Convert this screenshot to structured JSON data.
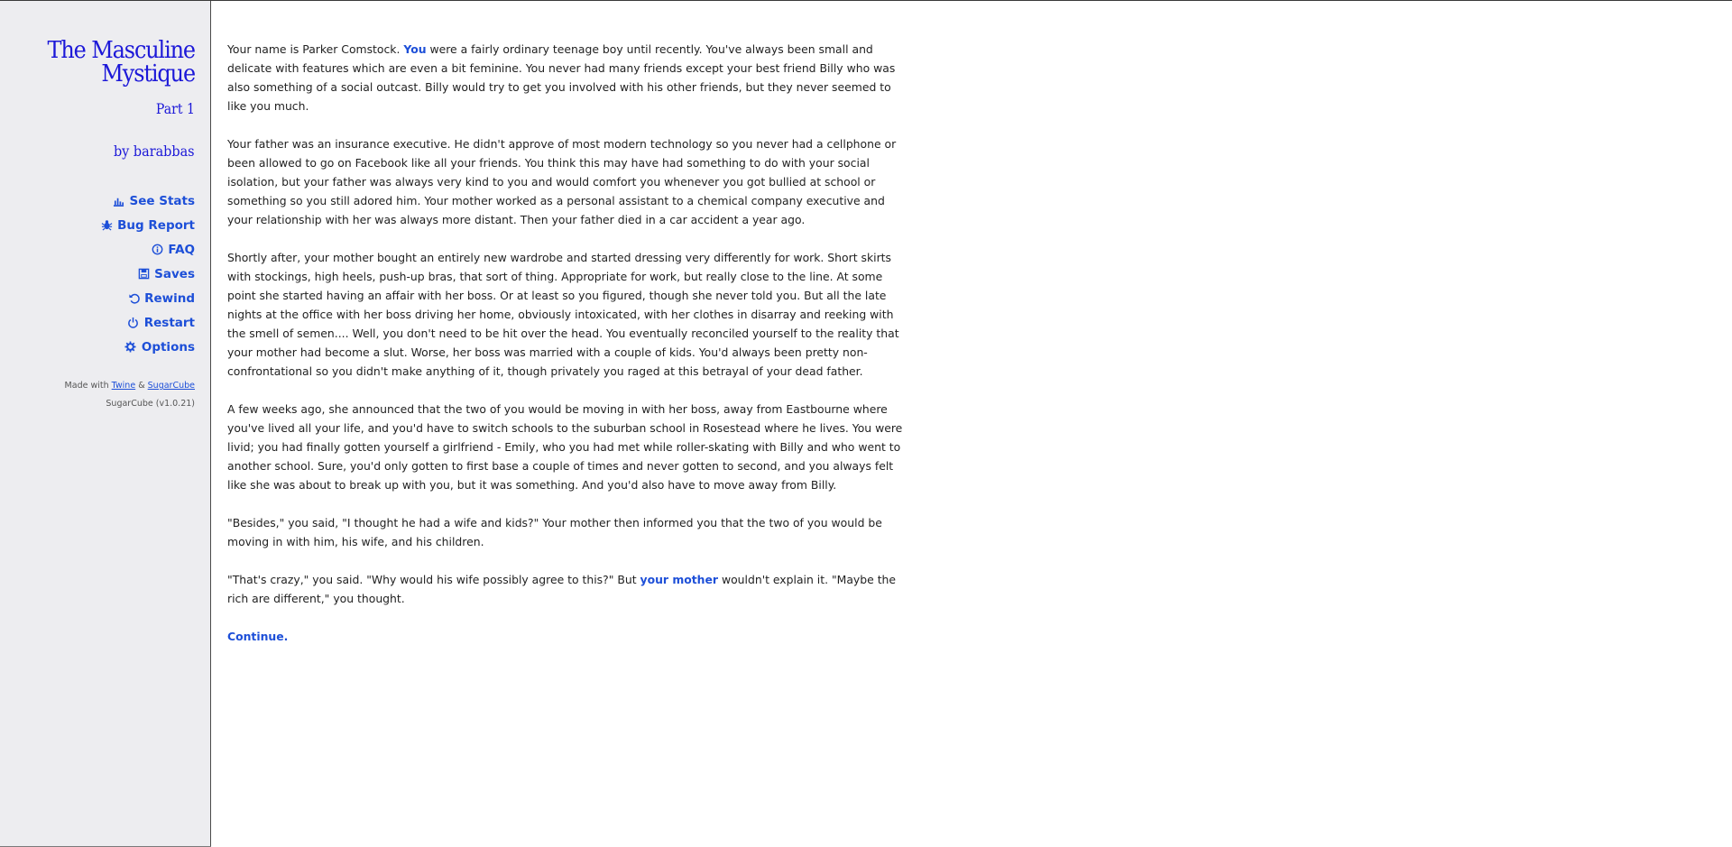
{
  "sidebar": {
    "title_line1": "The Masculine",
    "title_line2": "Mystique",
    "subtitle": "Part 1",
    "author": "by barabbas",
    "menu": [
      {
        "label": "See Stats",
        "icon": "bar-chart-icon"
      },
      {
        "label": "Bug Report",
        "icon": "bug-icon"
      },
      {
        "label": "FAQ",
        "icon": "info-icon"
      },
      {
        "label": "Saves",
        "icon": "floppy-disk-icon"
      },
      {
        "label": "Rewind",
        "icon": "undo-arrow-icon"
      },
      {
        "label": "Restart",
        "icon": "power-icon"
      },
      {
        "label": "Options",
        "icon": "gear-icon"
      }
    ],
    "credits": {
      "made_with": "Made with",
      "twine": "Twine",
      "amp": "&",
      "sugarcube": "SugarCube",
      "version": "SugarCube (v1.0.21)"
    }
  },
  "passage": {
    "p1_a": "Your name is Parker Comstock. ",
    "p1_link": "You",
    "p1_b": " were a fairly ordinary teenage boy until recently. You've always been small and delicate with features which are even a bit feminine. You never had many friends except your best friend Billy who was also something of a social outcast. Billy would try to get you involved with his other friends, but they never seemed to like you much.",
    "p2": "Your father was an insurance executive. He didn't approve of most modern technology so you never had a cellphone or been allowed to go on Facebook like all your friends. You think this may have had something to do with your social isolation, but your father was always very kind to you and would comfort you whenever you got bullied at school or something so you still adored him. Your mother worked as a personal assistant to a chemical company executive and your relationship with her was always more distant. Then your father died in a car accident a year ago.",
    "p3": "Shortly after, your mother bought an entirely new wardrobe and started dressing very differently for work. Short skirts with stockings, high heels, push-up bras, that sort of thing. Appropriate for work, but really close to the line. At some point she started having an affair with her boss. Or at least so you figured, though she never told you. But all the late nights at the office with her boss driving her home, obviously intoxicated, with her clothes in disarray and reeking with the smell of semen.... Well, you don't need to be hit over the head. You eventually reconciled yourself to the reality that your mother had become a slut. Worse, her boss was married with a couple of kids. You'd always been pretty non-confrontational so you didn't make anything of it, though privately you raged at this betrayal of your dead father.",
    "p4": "A few weeks ago, she announced that the two of you would be moving in with her boss, away from Eastbourne where you've lived all your life, and you'd have to switch schools to the suburban school in Rosestead where he lives. You were livid; you had finally gotten yourself a girlfriend - Emily, who you had met while roller-skating with Billy and who went to another school. Sure, you'd only gotten to first base a couple of times and never gotten to second, and you always felt like she was about to break up with you, but it was something. And you'd also have to move away from Billy.",
    "p5": "\"Besides,\" you said, \"I thought he had a wife and kids?\" Your mother then informed you that the two of you would be moving in with him, his wife, and his children.",
    "p6_a": "\"That's crazy,\" you said. \"Why would his wife possibly agree to this?\" But ",
    "p6_link": "your mother",
    "p6_b": " wouldn't explain it. \"Maybe the rich are different,\" you thought.",
    "continue": "Continue."
  },
  "colors": {
    "title": "#1c18d8",
    "link": "#1d4fd8",
    "sidebar_bg": "#ededf0"
  }
}
